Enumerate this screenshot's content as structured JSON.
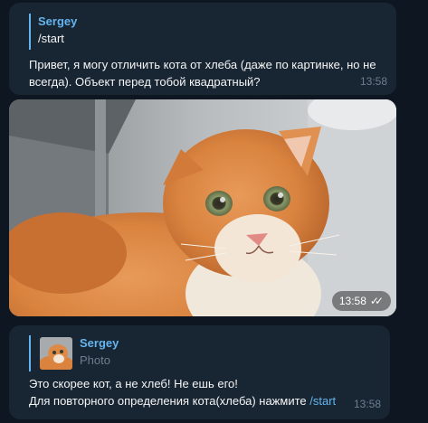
{
  "messages": [
    {
      "reply_name": "Sergey",
      "reply_text": "/start",
      "text_line1": "Привет, я могу отличить кота от хлеба (даже по картинке, но не",
      "text_line2": "всегда). Объект перед тобой квадратный?",
      "time": "13:58"
    },
    {
      "type": "photo",
      "photo_subject": "ginger-cat-photo",
      "time": "13:58",
      "status_icon": "double-check-icon"
    },
    {
      "reply_name": "Sergey",
      "reply_text": "Photo",
      "reply_thumbnail": "cat-thumbnail",
      "text_line1": "Это скорее кот, а не хлеб! Не ешь его!",
      "text_line2_prefix": "Для повторного определения кота(хлеба) нажмите ",
      "command": "/start",
      "time": "13:58"
    }
  ],
  "colors": {
    "background": "#0e1621",
    "bubble": "#182533",
    "accent": "#64b5ef",
    "text": "#f5f5f5",
    "muted": "#6d7f8f"
  }
}
